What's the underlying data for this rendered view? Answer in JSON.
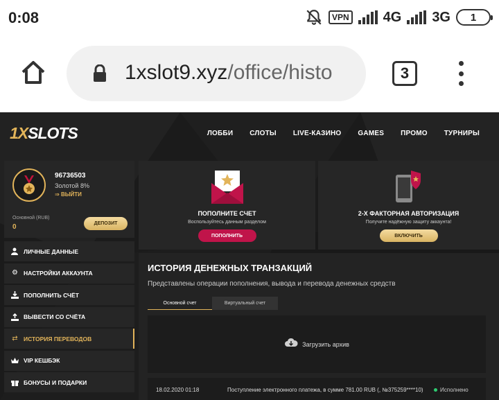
{
  "status_bar": {
    "time": "0:08",
    "vpn": "VPN",
    "network1": "4G",
    "network2": "3G",
    "battery": "1"
  },
  "browser": {
    "url_host": "1xslot9.xyz",
    "url_path": "/office/histo",
    "tab_count": "3"
  },
  "site": {
    "logo_highlight": "1X",
    "logo_text": "SLOTS",
    "nav": [
      "ЛОББИ",
      "СЛОТЫ",
      "LIVE-КАЗИНО",
      "GAMES",
      "ПРОМО",
      "ТУРНИРЫ"
    ],
    "profile": {
      "account_id": "96736503",
      "level": "Золотой 8%",
      "logout": "ВЫЙТИ",
      "balance_label": "Основной (RUB)",
      "balance_value": "0",
      "deposit_button": "ДЕПОЗИТ"
    },
    "side_menu": [
      {
        "icon": "user-icon",
        "label": "ЛИЧНЫЕ ДАННЫЕ"
      },
      {
        "icon": "gears-icon",
        "label": "НАСТРОЙКИ АККАУНТА"
      },
      {
        "icon": "download-icon",
        "label": "ПОПОЛНИТЬ СЧЁТ"
      },
      {
        "icon": "upload-icon",
        "label": "ВЫВЕСТИ СО СЧЁТА"
      },
      {
        "icon": "transfer-icon",
        "label": "ИСТОРИЯ ПЕРЕВОДОВ",
        "active": true
      },
      {
        "icon": "crown-icon",
        "label": "VIP КЕШБЭК"
      },
      {
        "icon": "gift-icon",
        "label": "БОНУСЫ И ПОДАРКИ"
      }
    ],
    "promo_deposit": {
      "title": "ПОПОЛНИТЕ СЧЕТ",
      "subtitle": "Воспользуйтесь данным разделом",
      "button": "ПОПОЛНИТЬ"
    },
    "promo_2fa": {
      "title": "2-Х ФАКТОРНАЯ АВТОРИЗАЦИЯ",
      "subtitle": "Получите надёжную защиту аккаунта!",
      "button": "ВКЛЮЧИТЬ"
    },
    "history": {
      "title": "ИСТОРИЯ ДЕНЕЖНЫХ ТРАНЗАКЦИЙ",
      "description": "Представлены операции пополнения, вывода и перевода денежных средств",
      "tab_main": "Основной счет",
      "tab_virtual": "Виртуальный счет",
      "archive_label": "Загрузить архив",
      "rows": [
        {
          "date": "18.02.2020 01:18",
          "description": "Поступление электронного платежа, в сумме 781.00 RUB (, №375259****10)",
          "status": "Исполнено"
        }
      ]
    },
    "colors": {
      "accent": "#e2b45a",
      "pink": "#c0144a",
      "success": "#2ecc71"
    }
  }
}
